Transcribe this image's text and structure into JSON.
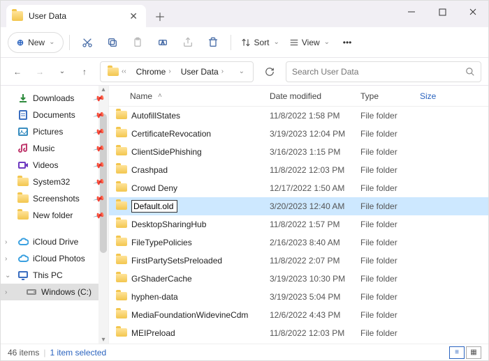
{
  "tab": {
    "title": "User Data"
  },
  "toolbar": {
    "new_label": "New",
    "sort_label": "Sort",
    "view_label": "View"
  },
  "address": {
    "seg1": "Chrome",
    "seg2": "User Data"
  },
  "search": {
    "placeholder": "Search User Data"
  },
  "sidebar": [
    {
      "name": "Downloads",
      "icon": "downloads",
      "pinned": true
    },
    {
      "name": "Documents",
      "icon": "documents",
      "pinned": true
    },
    {
      "name": "Pictures",
      "icon": "pictures",
      "pinned": true
    },
    {
      "name": "Music",
      "icon": "music",
      "pinned": true
    },
    {
      "name": "Videos",
      "icon": "videos",
      "pinned": true
    },
    {
      "name": "System32",
      "icon": "folder",
      "pinned": true
    },
    {
      "name": "Screenshots",
      "icon": "folder",
      "pinned": true
    },
    {
      "name": "New folder",
      "icon": "folder",
      "pinned": true
    }
  ],
  "drives": [
    {
      "name": "iCloud Drive",
      "icon": "icloud",
      "exp": "›"
    },
    {
      "name": "iCloud Photos",
      "icon": "icloud",
      "exp": "›"
    },
    {
      "name": "This PC",
      "icon": "pc",
      "exp": "⌄"
    },
    {
      "name": "Windows (C:)",
      "icon": "disk",
      "exp": "›",
      "sel": true
    }
  ],
  "columns": {
    "name": "Name",
    "date": "Date modified",
    "type": "Type",
    "size": "Size"
  },
  "files": [
    {
      "name": "AutofillStates",
      "date": "11/8/2022 1:58 PM",
      "type": "File folder"
    },
    {
      "name": "CertificateRevocation",
      "date": "3/19/2023 12:04 PM",
      "type": "File folder"
    },
    {
      "name": "ClientSidePhishing",
      "date": "3/16/2023 1:15 PM",
      "type": "File folder"
    },
    {
      "name": "Crashpad",
      "date": "11/8/2022 12:03 PM",
      "type": "File folder"
    },
    {
      "name": "Crowd Deny",
      "date": "12/17/2022 1:50 AM",
      "type": "File folder"
    },
    {
      "name": "Default.old",
      "date": "3/20/2023 12:40 AM",
      "type": "File folder",
      "rename": true,
      "sel": true
    },
    {
      "name": "DesktopSharingHub",
      "date": "11/8/2022 1:57 PM",
      "type": "File folder"
    },
    {
      "name": "FileTypePolicies",
      "date": "2/16/2023 8:40 AM",
      "type": "File folder"
    },
    {
      "name": "FirstPartySetsPreloaded",
      "date": "11/8/2022 2:07 PM",
      "type": "File folder"
    },
    {
      "name": "GrShaderCache",
      "date": "3/19/2023 10:30 PM",
      "type": "File folder"
    },
    {
      "name": "hyphen-data",
      "date": "3/19/2023 5:04 PM",
      "type": "File folder"
    },
    {
      "name": "MediaFoundationWidevineCdm",
      "date": "12/6/2022 4:43 PM",
      "type": "File folder"
    },
    {
      "name": "MEIPreload",
      "date": "11/8/2022 12:03 PM",
      "type": "File folder"
    }
  ],
  "status": {
    "count": "46 items",
    "selected": "1 item selected"
  }
}
